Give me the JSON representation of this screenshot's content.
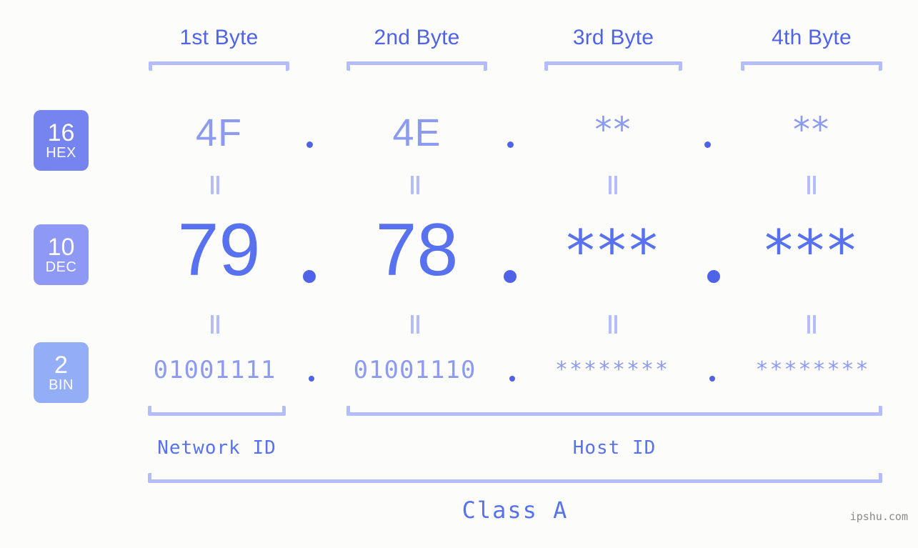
{
  "watermark": "ipshu.com",
  "byte_headers": [
    {
      "label": "1st Byte"
    },
    {
      "label": "2nd Byte"
    },
    {
      "label": "3rd Byte"
    },
    {
      "label": "4th Byte"
    }
  ],
  "radix_badges": [
    {
      "number": "16",
      "name": "HEX",
      "color": "#7684f0"
    },
    {
      "number": "10",
      "name": "DEC",
      "color": "#8d99f5"
    },
    {
      "number": "2",
      "name": "BIN",
      "color": "#94adf7"
    }
  ],
  "rows": {
    "hex": {
      "values": [
        "4F",
        "4E",
        "**",
        "**"
      ],
      "separator": "."
    },
    "dec": {
      "values": [
        "79",
        "78",
        "***",
        "***"
      ],
      "separator": "."
    },
    "bin": {
      "values": [
        "01001111",
        "01001110",
        "********",
        "********"
      ],
      "separator": "."
    }
  },
  "equality_marks": {
    "glyph": "=",
    "count_per_row": 4,
    "rows": 2
  },
  "id_sections": [
    {
      "label": "Network ID"
    },
    {
      "label": "Host ID"
    }
  ],
  "class_section": {
    "label": "Class A"
  },
  "colors": {
    "background": "#fcfdfa",
    "header_text": "#4f63e8",
    "bracket": "#b4bdfb",
    "hex_text": "#8c9bf0",
    "dec_text": "#5871ee",
    "bin_text": "#8c9bf0",
    "dot": "#4f63e8",
    "watermark": "#8a8a8a"
  }
}
